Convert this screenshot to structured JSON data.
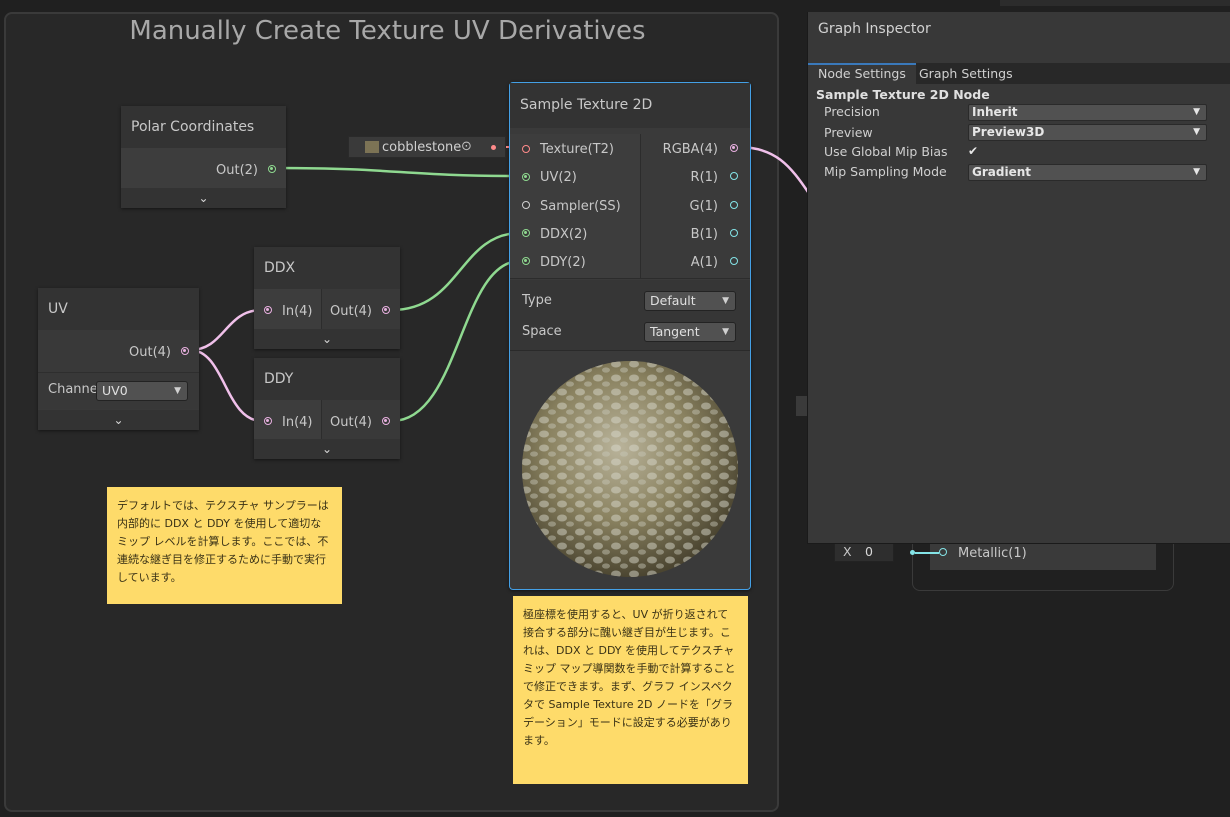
{
  "group": {
    "title": "Manually Create Texture UV Derivatives"
  },
  "polar_node": {
    "title": "Polar Coordinates",
    "out": "Out(2)"
  },
  "texture_property": {
    "label": "cobblestone"
  },
  "uv_node": {
    "title": "UV",
    "out": "Out(4)",
    "channel_label": "Channe",
    "channel_value": "UV0"
  },
  "ddx_node": {
    "title": "DDX",
    "in": "In(4)",
    "out": "Out(4)"
  },
  "ddy_node": {
    "title": "DDY",
    "in": "In(4)",
    "out": "Out(4)"
  },
  "sample_node": {
    "title": "Sample Texture 2D",
    "inputs": [
      "Texture(T2)",
      "UV(2)",
      "Sampler(SS)",
      "DDX(2)",
      "DDY(2)"
    ],
    "outputs": [
      "RGBA(4)",
      "R(1)",
      "G(1)",
      "B(1)",
      "A(1)"
    ],
    "type_label": "Type",
    "type_value": "Default",
    "space_label": "Space",
    "space_value": "Tangent"
  },
  "sticky_left": {
    "text": "デフォルトでは、テクスチャ サンプラーは内部的に DDX と DDY を使用して適切なミップ レベルを計算します。ここでは、不連続な継ぎ目を修正するために手動で実行しています。"
  },
  "sticky_bottom": {
    "text": "極座標を使用すると、UV が折り返されて接合する部分に醜い継ぎ目が生じます。これは、DDX と DDY を使用してテクスチャ ミップ マップ導関数を手動で計算することで修正できます。まず、グラフ インスペクタで Sample Texture 2D ノードを「グラデーション」モードに設定する必要があります。"
  },
  "metallic": {
    "x_label": "X",
    "x_value": "0",
    "port": "Metallic(1)"
  },
  "inspector": {
    "title": "Graph Inspector",
    "tabs": [
      "Node Settings",
      "Graph Settings"
    ],
    "section": "Sample Texture 2D Node",
    "rows": [
      {
        "label": "Precision",
        "value": "Inherit"
      },
      {
        "label": "Preview",
        "value": "Preview3D"
      },
      {
        "label": "Use Global Mip Bias",
        "value": "✔"
      },
      {
        "label": "Mip Sampling Mode",
        "value": "Gradient"
      }
    ]
  },
  "colors": {
    "vector2_wire": "#8fd990",
    "vector4_wire": "#f0c0ea",
    "texture_port": "#ff8b8b",
    "float_port": "#84e4e7",
    "sticky": "#fedb6a",
    "selection": "#44a0e6"
  }
}
